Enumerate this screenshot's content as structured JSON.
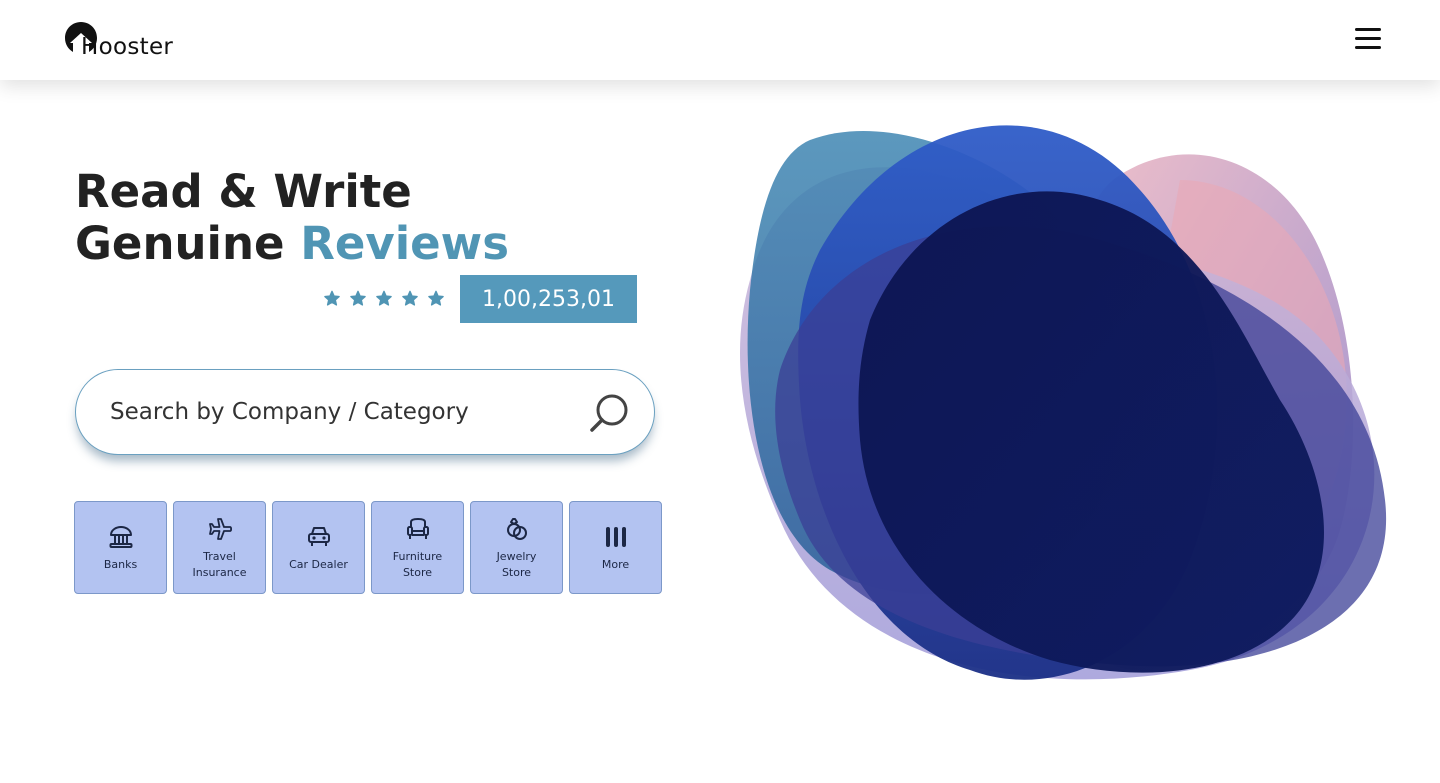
{
  "brand": {
    "name": "Hooster",
    "icon": "logo-mark-icon"
  },
  "nav": {
    "menu_icon": "hamburger-menu-icon"
  },
  "hero": {
    "headline_line1": "Read & Write",
    "headline_line2_prefix": "Genuine",
    "headline_line2_accent": "Reviews",
    "rating_stars": 5,
    "review_count": "1,00,253,01"
  },
  "search": {
    "placeholder": "Search by Company / Category",
    "value": "",
    "icon": "search-icon"
  },
  "categories": [
    {
      "label": "Banks",
      "icon": "bank-icon"
    },
    {
      "label": "Travel Insurance",
      "icon": "airplane-icon"
    },
    {
      "label": "Car Dealer",
      "icon": "car-icon"
    },
    {
      "label": "Furniture Store",
      "icon": "armchair-icon"
    },
    {
      "label": "Jewelry Store",
      "icon": "rings-icon"
    },
    {
      "label": "More",
      "icon": "more-icon"
    }
  ],
  "colors": {
    "accent": "#5095b4",
    "badge": "#5599bb",
    "category_bg": "#b3c3f1",
    "category_border": "#7c98c9",
    "headline": "#222222"
  }
}
